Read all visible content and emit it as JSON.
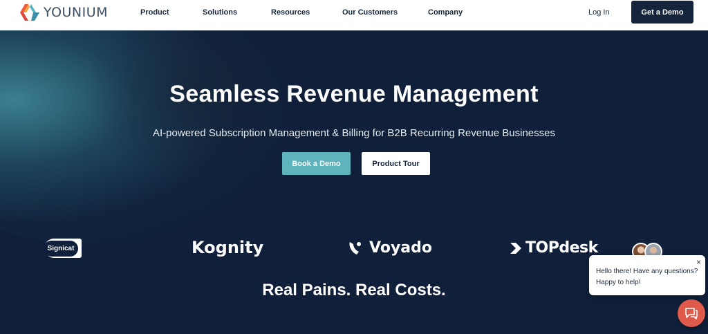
{
  "brand": {
    "name": "YOUNIUM"
  },
  "nav": {
    "items": [
      {
        "label": "Product"
      },
      {
        "label": "Solutions"
      },
      {
        "label": "Resources"
      },
      {
        "label": "Our Customers"
      },
      {
        "label": "Company"
      }
    ],
    "login": "Log In",
    "cta": "Get a Demo"
  },
  "hero": {
    "title": "Seamless Revenue Management",
    "subtitle": "AI-powered Subscription Management & Billing for B2B Recurring Revenue Businesses",
    "primary_button": "Book a Demo",
    "secondary_button": "Product Tour"
  },
  "clients": [
    {
      "name": "Signicat"
    },
    {
      "name": "Kognity"
    },
    {
      "name": "Voyado"
    },
    {
      "name": "TOPdesk"
    }
  ],
  "section": {
    "title": "Real Pains. Real Costs."
  },
  "chat": {
    "line1": "Hello there! Have any questions?",
    "line2": "Happy to help!",
    "close": "×"
  },
  "colors": {
    "header_bg": "#ffffff",
    "hero_bg": "#10203a",
    "accent_teal": "#5fb3bd",
    "chat_button": "#e05a4b",
    "cta_dark": "#13243b"
  },
  "icons": [
    "younium-logo-icon",
    "voyado-icon",
    "topdesk-icon",
    "close-icon",
    "chat-icon"
  ]
}
